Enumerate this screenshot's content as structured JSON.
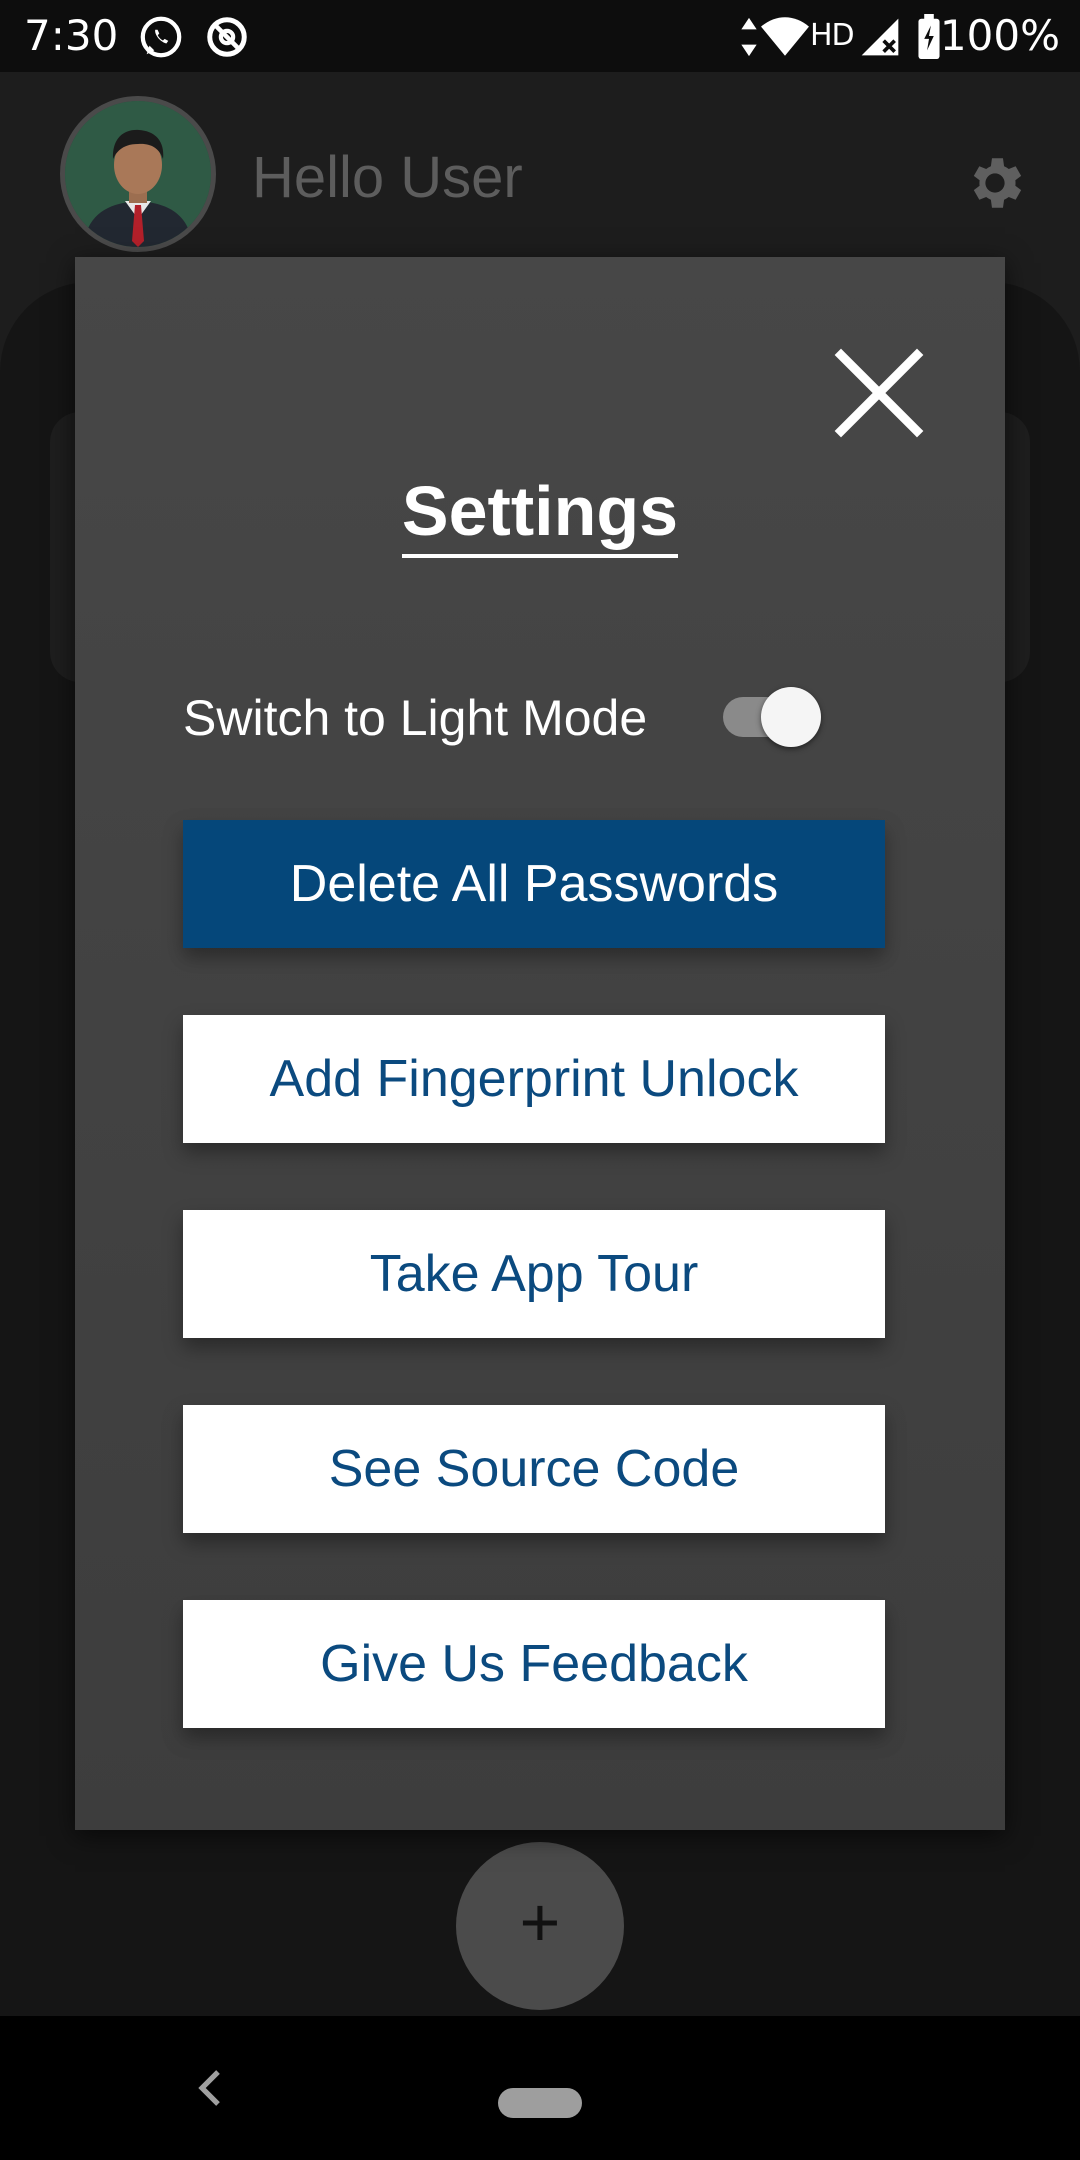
{
  "status_bar": {
    "time": "7:30",
    "network_type": "HD",
    "battery": "100%",
    "icons": [
      "whatsapp-icon",
      "data-saver-icon",
      "data-arrows-icon",
      "wifi-icon",
      "signal-icon",
      "battery-charging-icon"
    ]
  },
  "header": {
    "greeting": "Hello User",
    "avatar_icon": "user-avatar",
    "settings_icon": "gear-icon"
  },
  "fab": {
    "label": "+"
  },
  "modal": {
    "title": "Settings",
    "close_icon": "close-icon",
    "toggle": {
      "label": "Switch to Light Mode",
      "checked": true
    },
    "buttons": [
      {
        "label": "Delete All Passwords",
        "style": "primary"
      },
      {
        "label": "Add Fingerprint Unlock",
        "style": "secondary"
      },
      {
        "label": "Take App Tour",
        "style": "secondary"
      },
      {
        "label": "See Source Code",
        "style": "secondary"
      },
      {
        "label": "Give Us Feedback",
        "style": "secondary"
      }
    ]
  },
  "colors": {
    "primary_button": "#05477a",
    "button_text": "#0b4a7f",
    "modal_background": "#444444"
  }
}
